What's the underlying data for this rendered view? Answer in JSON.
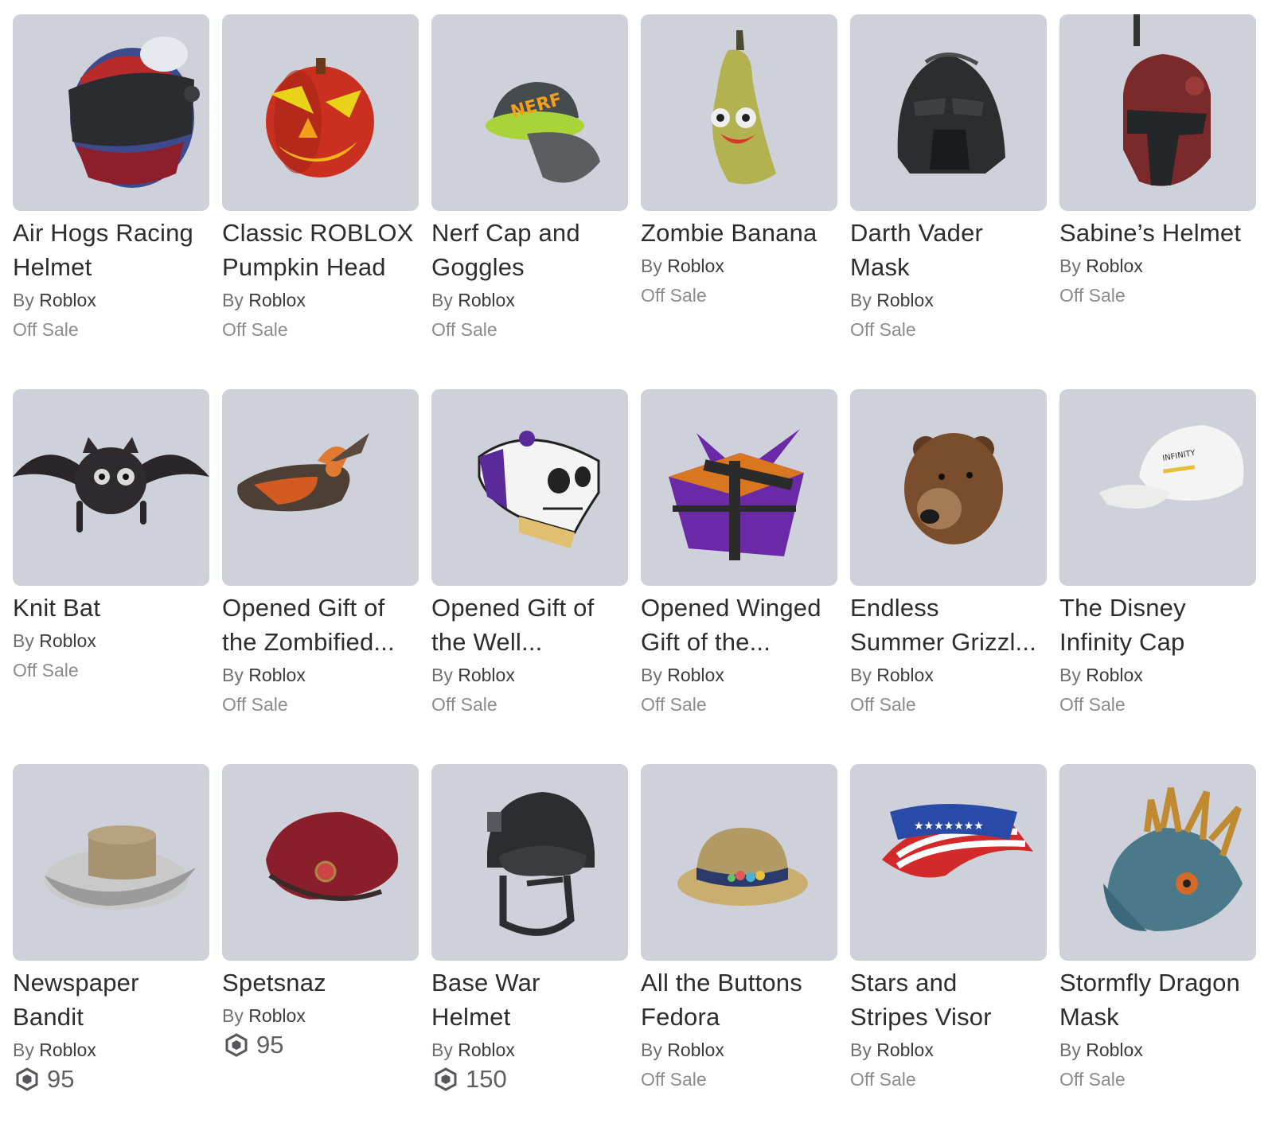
{
  "items": [
    {
      "name_lines": [
        "Air Hogs Racing",
        "Helmet"
      ],
      "by": "By",
      "creator": "Roblox",
      "price": "Off Sale",
      "robux": false,
      "icon": "racing-helmet-icon"
    },
    {
      "name_lines": [
        "Classic ROBLOX",
        "Pumpkin Head"
      ],
      "by": "By",
      "creator": "Roblox",
      "price": "Off Sale",
      "robux": false,
      "icon": "pumpkin-head-icon"
    },
    {
      "name_lines": [
        "Nerf Cap and",
        "Goggles"
      ],
      "by": "By",
      "creator": "Roblox",
      "price": "Off Sale",
      "robux": false,
      "icon": "nerf-cap-icon"
    },
    {
      "name_lines": [
        "Zombie Banana"
      ],
      "by": "By",
      "creator": "Roblox",
      "price": "Off Sale",
      "robux": false,
      "icon": "zombie-banana-icon"
    },
    {
      "name_lines": [
        "Darth Vader",
        "Mask"
      ],
      "by": "By",
      "creator": "Roblox",
      "price": "Off Sale",
      "robux": false,
      "icon": "vader-mask-icon"
    },
    {
      "name_lines": [
        "Sabine’s Helmet"
      ],
      "by": "By",
      "creator": "Roblox",
      "price": "Off Sale",
      "robux": false,
      "icon": "sabine-helmet-icon"
    },
    {
      "name_lines": [
        "Knit Bat"
      ],
      "by": "By",
      "creator": "Roblox",
      "price": "Off Sale",
      "robux": false,
      "icon": "knit-bat-icon"
    },
    {
      "name_lines": [
        "Opened Gift of",
        "the Zombified..."
      ],
      "by": "By",
      "creator": "Roblox",
      "price": "Off Sale",
      "robux": false,
      "icon": "zombified-gift-icon"
    },
    {
      "name_lines": [
        "Opened Gift of",
        "the Well..."
      ],
      "by": "By",
      "creator": "Roblox",
      "price": "Off Sale",
      "robux": false,
      "icon": "skull-gift-icon"
    },
    {
      "name_lines": [
        "Opened Winged",
        "Gift of the..."
      ],
      "by": "By",
      "creator": "Roblox",
      "price": "Off Sale",
      "robux": false,
      "icon": "winged-gift-icon"
    },
    {
      "name_lines": [
        "Endless",
        "Summer Grizzl..."
      ],
      "by": "By",
      "creator": "Roblox",
      "price": "Off Sale",
      "robux": false,
      "icon": "grizzly-head-icon"
    },
    {
      "name_lines": [
        "The Disney",
        "Infinity Cap"
      ],
      "by": "By",
      "creator": "Roblox",
      "price": "Off Sale",
      "robux": false,
      "icon": "disney-cap-icon"
    },
    {
      "name_lines": [
        "Newspaper",
        "Bandit"
      ],
      "by": "By",
      "creator": "Roblox",
      "price": "95",
      "robux": true,
      "icon": "newspaper-hat-icon"
    },
    {
      "name_lines": [
        "Spetsnaz"
      ],
      "by": "By",
      "creator": "Roblox",
      "price": "95",
      "robux": true,
      "icon": "beret-icon"
    },
    {
      "name_lines": [
        "Base War",
        "Helmet"
      ],
      "by": "By",
      "creator": "Roblox",
      "price": "150",
      "robux": true,
      "icon": "war-helmet-icon"
    },
    {
      "name_lines": [
        "All the Buttons",
        "Fedora"
      ],
      "by": "By",
      "creator": "Roblox",
      "price": "Off Sale",
      "robux": false,
      "icon": "fedora-icon"
    },
    {
      "name_lines": [
        "Stars and",
        "Stripes Visor"
      ],
      "by": "By",
      "creator": "Roblox",
      "price": "Off Sale",
      "robux": false,
      "icon": "flag-visor-icon"
    },
    {
      "name_lines": [
        "Stormfly Dragon",
        "Mask"
      ],
      "by": "By",
      "creator": "Roblox",
      "price": "Off Sale",
      "robux": false,
      "icon": "dragon-mask-icon"
    }
  ],
  "colors": {
    "thumb_bg": "#cfd1da",
    "name": "#2b2d2f",
    "muted": "#8a8c8f"
  }
}
